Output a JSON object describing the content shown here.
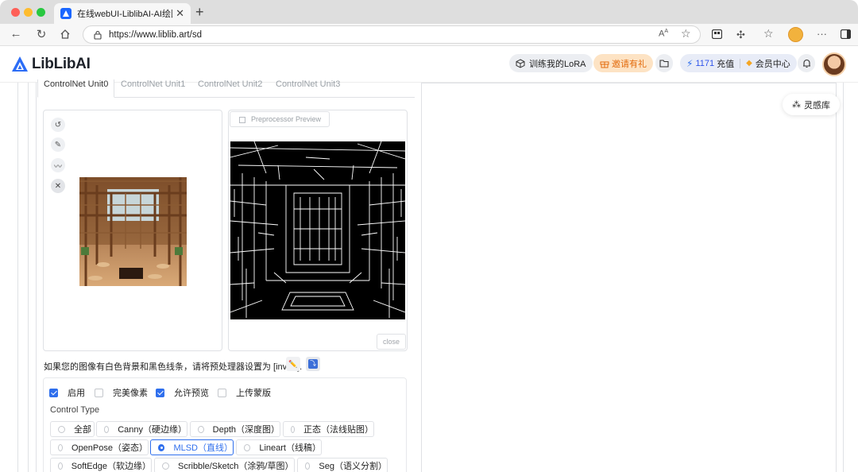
{
  "browser": {
    "tab_title": "在线webUI-LiblibAI-AI绘图工具",
    "url": "https://www.liblib.art/sd",
    "new_tab": "+",
    "tab_close": "✕"
  },
  "header": {
    "logo": "LibLibAI",
    "train_lora": "训练我的LoRA",
    "invite": "邀请有礼",
    "points": "1171",
    "recharge": "充值",
    "member_center": "会员中心"
  },
  "controlnet": {
    "tabs": [
      "ControlNet Unit0",
      "ControlNet Unit1",
      "ControlNet Unit2",
      "ControlNet Unit3"
    ],
    "preprocessor_preview": "Preprocessor Preview",
    "close": "close",
    "invert_tip": "如果您的图像有白色背景和黑色线条，请将预处理器设置为 [invert].",
    "checkboxes": [
      {
        "label": "启用",
        "checked": true
      },
      {
        "label": "完美像素",
        "checked": false
      },
      {
        "label": "允许预览",
        "checked": true
      },
      {
        "label": "上传蒙版",
        "checked": false
      }
    ],
    "control_type_label": "Control Type",
    "control_types": [
      {
        "label": "全部",
        "selected": false
      },
      {
        "label": "Canny（硬边缘）",
        "selected": false
      },
      {
        "label": "Depth（深度图）",
        "selected": false
      },
      {
        "label": "正态（法线贴图）",
        "selected": false
      },
      {
        "label": "OpenPose（姿态）",
        "selected": false
      },
      {
        "label": "MLSD（直线）",
        "selected": true
      },
      {
        "label": "Lineart（线稿）",
        "selected": false
      },
      {
        "label": "SoftEdge（软边缘）",
        "selected": false
      },
      {
        "label": "Scribble/Sketch（涂鸦/草图）",
        "selected": false
      },
      {
        "label": "Seg（语义分割）",
        "selected": false
      }
    ]
  },
  "sidebar": {
    "inspiration": "灵感库"
  },
  "colors": {
    "accent": "#2f6fed",
    "invite_text": "#e36b0c",
    "invite_bg": "#fde3c4"
  }
}
